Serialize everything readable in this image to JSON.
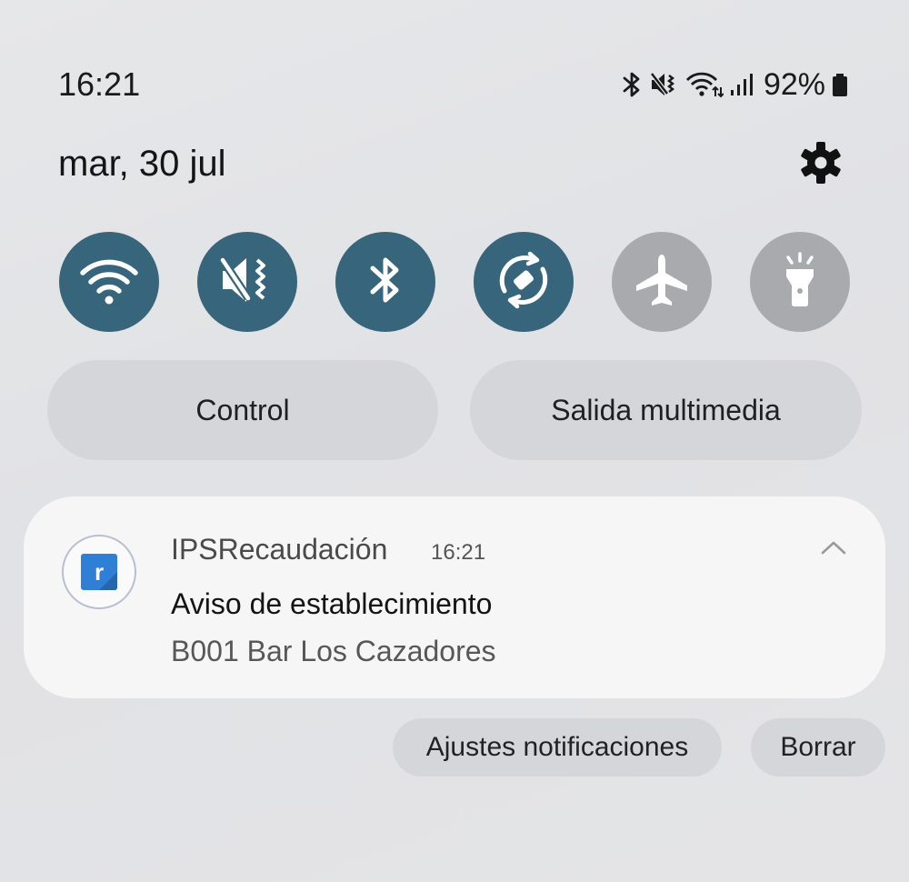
{
  "status_bar": {
    "time": "16:21",
    "battery_percent": "92%",
    "icons": [
      "bluetooth-icon",
      "vibrate-mute-icon",
      "wifi-data-icon",
      "signal-icon",
      "battery-icon"
    ]
  },
  "header": {
    "date": "mar, 30 jul",
    "settings_icon": "gear-icon"
  },
  "quick_toggles": [
    {
      "name": "wifi",
      "icon": "wifi-icon",
      "state": "on"
    },
    {
      "name": "sound",
      "icon": "vibrate-mute-icon",
      "state": "on"
    },
    {
      "name": "bluetooth",
      "icon": "bluetooth-icon",
      "state": "on"
    },
    {
      "name": "auto-rotate",
      "icon": "auto-rotate-icon",
      "state": "on"
    },
    {
      "name": "airplane",
      "icon": "airplane-icon",
      "state": "off"
    },
    {
      "name": "flashlight",
      "icon": "flashlight-icon",
      "state": "off"
    }
  ],
  "panel_buttons": {
    "control": "Control",
    "media_output": "Salida multimedia"
  },
  "notification": {
    "app_icon_letter": "r",
    "app_name": "IPSRecaudación",
    "time": "16:21",
    "title": "Aviso de establecimiento",
    "text": "B001 Bar Los Cazadores"
  },
  "actions": {
    "settings": "Ajustes notificaciones",
    "clear": "Borrar"
  },
  "colors": {
    "toggle_on": "#36657c",
    "toggle_off": "#a9aaad",
    "card": "#f6f6f6",
    "button": "#d5d6d9"
  }
}
